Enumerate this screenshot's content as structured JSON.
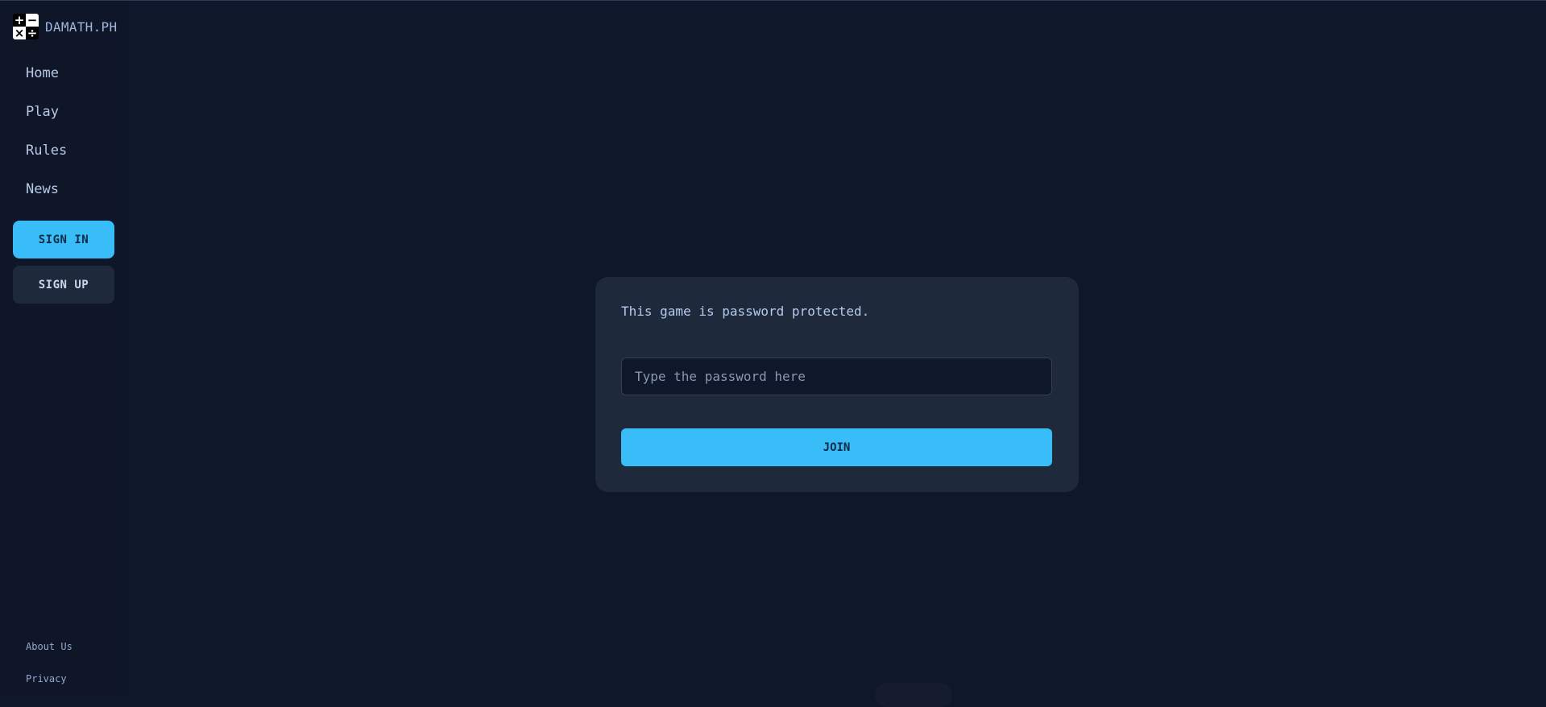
{
  "brand": {
    "name": "DAMATH.PH",
    "logo_symbols": [
      "+",
      "−",
      "×",
      "÷"
    ],
    "logo_icon": "math-operators-icon"
  },
  "sidebar": {
    "nav": [
      {
        "label": "Home"
      },
      {
        "label": "Play"
      },
      {
        "label": "Rules"
      },
      {
        "label": "News"
      }
    ],
    "sign_in_label": "SIGN IN",
    "sign_up_label": "SIGN UP",
    "footer": [
      {
        "label": "About Us"
      },
      {
        "label": "Privacy"
      }
    ]
  },
  "dialog": {
    "message": "This game is password protected.",
    "password_value": "",
    "password_placeholder": "Type the password here",
    "join_label": "JOIN"
  },
  "colors": {
    "background": "#0f172a",
    "card": "#1e293b",
    "accent": "#38bdf8"
  }
}
